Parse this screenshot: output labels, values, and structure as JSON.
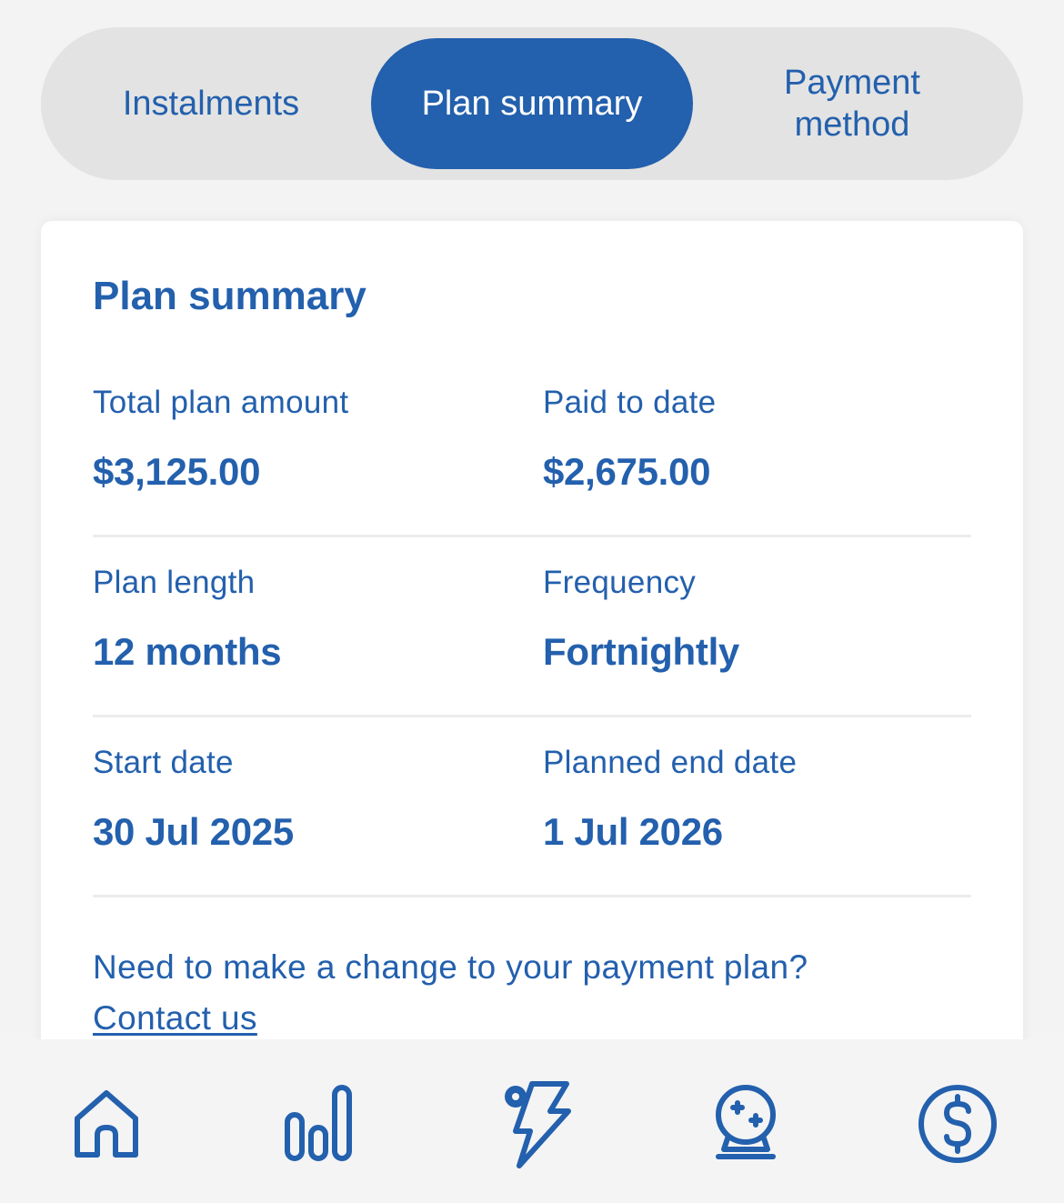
{
  "tabs": [
    {
      "label": "Instalments",
      "active": false
    },
    {
      "label": "Plan summary",
      "active": true
    },
    {
      "label": "Payment\nmethod",
      "active": false
    }
  ],
  "card": {
    "title": "Plan summary",
    "rows": [
      {
        "left": {
          "label": "Total plan amount",
          "value": "$3,125.00"
        },
        "right": {
          "label": "Paid to date",
          "value": "$2,675.00"
        }
      },
      {
        "left": {
          "label": "Plan length",
          "value": "12 months"
        },
        "right": {
          "label": "Frequency",
          "value": "Fortnightly"
        }
      },
      {
        "left": {
          "label": "Start date",
          "value": "30 Jul 2025"
        },
        "right": {
          "label": "Planned end date",
          "value": "1 Jul 2026"
        }
      }
    ],
    "note": {
      "question": "Need to make a change to your payment plan?",
      "link_label": "Contact us"
    }
  },
  "bottom_nav": [
    {
      "icon": "home-icon"
    },
    {
      "icon": "usage-bars-icon"
    },
    {
      "icon": "energy-bolt-icon"
    },
    {
      "icon": "gaming-orb-icon"
    },
    {
      "icon": "dollar-circle-icon"
    }
  ],
  "colors": {
    "brand_blue": "#2360ad",
    "tab_track": "#e3e3e3",
    "page_bg": "#f3f3f3",
    "card_bg": "#ffffff"
  }
}
